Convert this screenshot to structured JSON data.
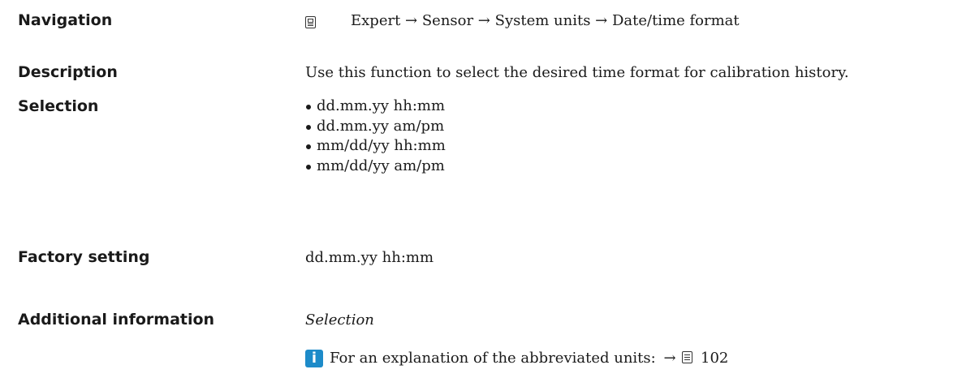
{
  "navigation": {
    "label": "Navigation",
    "icon": "menu-icon",
    "path": "Expert → Sensor → System units → Date/time format"
  },
  "description": {
    "label": "Description",
    "text": "Use this function to select the desired time format for calibration history."
  },
  "selection": {
    "label": "Selection",
    "options": [
      "dd.mm.yy hh:mm",
      "dd.mm.yy am/pm",
      "mm/dd/yy hh:mm",
      "mm/dd/yy am/pm"
    ]
  },
  "factory_setting": {
    "label": "Factory setting",
    "value": "dd.mm.yy hh:mm"
  },
  "additional_information": {
    "label": "Additional information",
    "subheading": "Selection",
    "info_icon": "info-icon",
    "info_icon_color": "#1d8bc9",
    "note_text": "For an explanation of the abbreviated units:",
    "arrow": "→",
    "page_icon": "book-icon",
    "page_ref": "102"
  }
}
